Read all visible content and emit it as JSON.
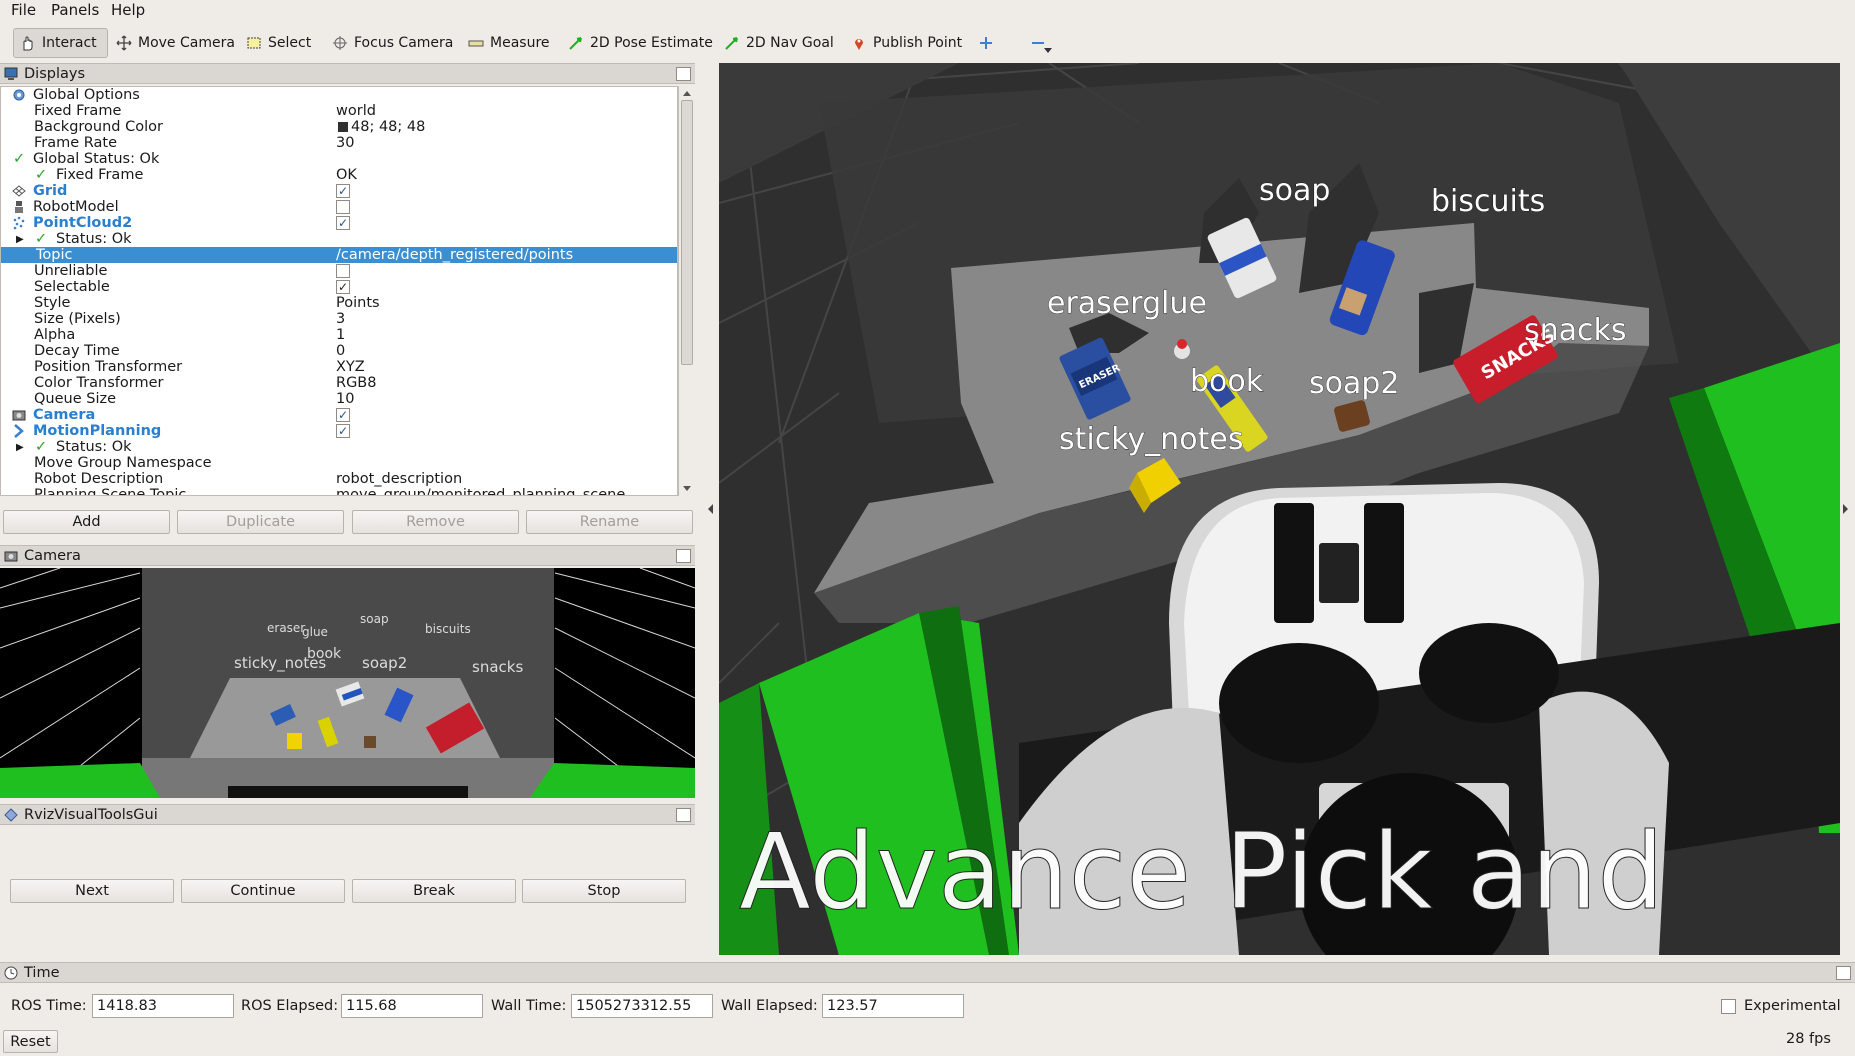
{
  "menubar": {
    "file": "File",
    "panels": "Panels",
    "help": "Help"
  },
  "toolbar": {
    "interact": "Interact",
    "move_camera": "Move Camera",
    "select": "Select",
    "focus_camera": "Focus Camera",
    "measure": "Measure",
    "pose_estimate": "2D Pose Estimate",
    "nav_goal": "2D Nav Goal",
    "publish_point": "Publish Point"
  },
  "displays": {
    "title": "Displays",
    "rows": [
      {
        "name": "Global Options",
        "value": ""
      },
      {
        "name": "Fixed Frame",
        "value": "world"
      },
      {
        "name": "Background Color",
        "value": "48; 48; 48"
      },
      {
        "name": "Frame Rate",
        "value": "30"
      },
      {
        "name": "Global Status: Ok",
        "value": ""
      },
      {
        "name": "Fixed Frame",
        "value": "OK"
      },
      {
        "name": "Grid",
        "value": ""
      },
      {
        "name": "RobotModel",
        "value": ""
      },
      {
        "name": "PointCloud2",
        "value": ""
      },
      {
        "name": "Status: Ok",
        "value": ""
      },
      {
        "name": "Topic",
        "value": "/camera/depth_registered/points"
      },
      {
        "name": "Unreliable",
        "value": ""
      },
      {
        "name": "Selectable",
        "value": ""
      },
      {
        "name": "Style",
        "value": "Points"
      },
      {
        "name": "Size (Pixels)",
        "value": "3"
      },
      {
        "name": "Alpha",
        "value": "1"
      },
      {
        "name": "Decay Time",
        "value": "0"
      },
      {
        "name": "Position Transformer",
        "value": "XYZ"
      },
      {
        "name": "Color Transformer",
        "value": "RGB8"
      },
      {
        "name": "Queue Size",
        "value": "10"
      },
      {
        "name": "Camera",
        "value": ""
      },
      {
        "name": "MotionPlanning",
        "value": ""
      },
      {
        "name": "Status: Ok",
        "value": ""
      },
      {
        "name": "Move Group Namespace",
        "value": ""
      },
      {
        "name": "Robot Description",
        "value": "robot_description"
      },
      {
        "name": "Planning Scene Topic",
        "value": "move_group/monitored_planning_scene"
      }
    ],
    "buttons": {
      "add": "Add",
      "duplicate": "Duplicate",
      "remove": "Remove",
      "rename": "Rename"
    }
  },
  "camera_panel": {
    "title": "Camera",
    "labels": [
      "eraser",
      "glue",
      "soap",
      "biscuits",
      "book",
      "sticky_notes",
      "soap2",
      "snacks"
    ]
  },
  "rviz_tools": {
    "title": "RvizVisualToolsGui",
    "next": "Next",
    "continue": "Continue",
    "break": "Break",
    "stop": "Stop"
  },
  "scene": {
    "labels": {
      "soap": "soap",
      "biscuits": "biscuits",
      "eraserglue": "eraserglue",
      "snacks": "snacks",
      "book": "book",
      "soap2": "soap2",
      "sticky_notes": "sticky_notes"
    },
    "overlay_text": "Advance  Pick  and",
    "package_texts": {
      "eraser": "ERASER",
      "snacks": "SNACKS"
    }
  },
  "time": {
    "title": "Time",
    "ros_time_label": "ROS Time:",
    "ros_time": "1418.83",
    "ros_elapsed_label": "ROS Elapsed:",
    "ros_elapsed": "115.68",
    "wall_time_label": "Wall Time:",
    "wall_time": "1505273312.55",
    "wall_elapsed_label": "Wall Elapsed:",
    "wall_elapsed": "123.57",
    "experimental": "Experimental",
    "reset": "Reset",
    "fps": "28 fps"
  },
  "colors": {
    "selection": "#3a8fd2",
    "link_blue": "#2a7fcf",
    "robot_green": "#1fbf1f",
    "background": "#303030"
  }
}
